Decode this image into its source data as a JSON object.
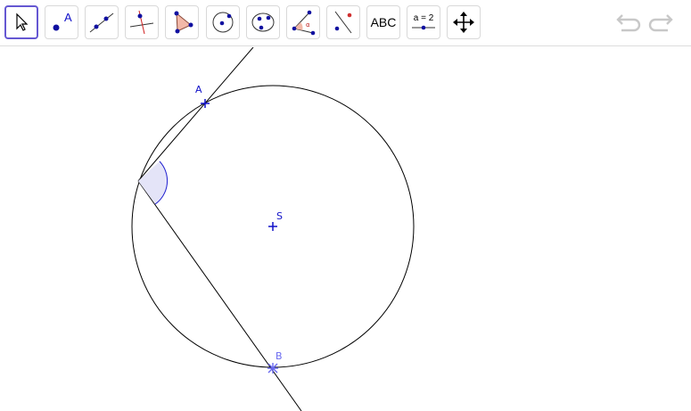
{
  "toolbar": {
    "tools": [
      {
        "name": "move",
        "icon": "move-arrow-icon",
        "active": true
      },
      {
        "name": "point",
        "icon": "point-icon",
        "label": "A"
      },
      {
        "name": "line",
        "icon": "line-through-two-points-icon"
      },
      {
        "name": "perpendicular",
        "icon": "perpendicular-line-icon"
      },
      {
        "name": "polygon",
        "icon": "polygon-icon"
      },
      {
        "name": "circle-center-point",
        "icon": "circle-center-point-icon"
      },
      {
        "name": "circle-three-points",
        "icon": "circle-three-points-icon"
      },
      {
        "name": "angle",
        "icon": "angle-icon",
        "label": "α"
      },
      {
        "name": "reflect",
        "icon": "reflect-about-line-icon"
      },
      {
        "name": "text",
        "icon": "text-icon",
        "label": "ABC"
      },
      {
        "name": "slider",
        "icon": "slider-icon",
        "label": "a = 2"
      },
      {
        "name": "move-graphics-view",
        "icon": "move-graphics-view-icon"
      }
    ],
    "undo_icon": "undo-icon",
    "redo_icon": "redo-icon"
  },
  "construction": {
    "point_A_label": "A",
    "point_S_label": "S",
    "point_B_label": "B"
  },
  "colors": {
    "accent": "#6557d2",
    "point_blue": "#1010c8",
    "point_light": "#6a6af0",
    "angle_fill": "#e4e4f8",
    "angle_stroke": "#2020d0"
  }
}
